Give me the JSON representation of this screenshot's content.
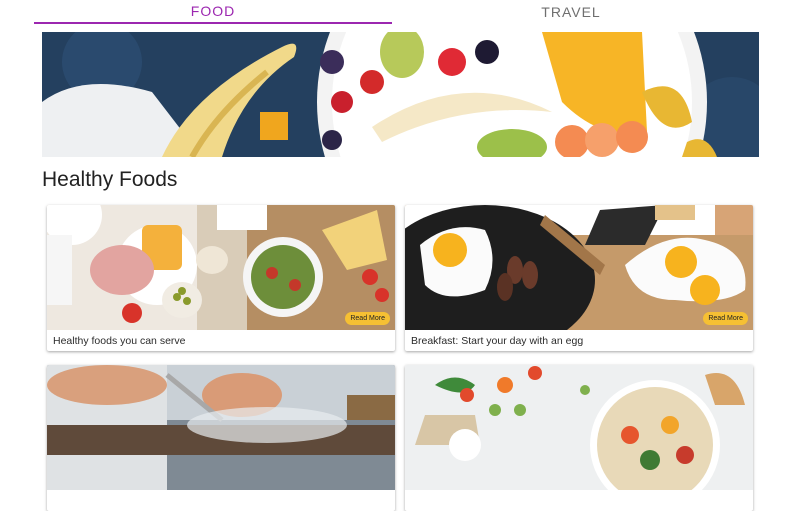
{
  "tabs": [
    {
      "label": "FOOD",
      "active": true
    },
    {
      "label": "TRAVEL",
      "active": false
    }
  ],
  "section": {
    "title": "Healthy Foods"
  },
  "cards": [
    {
      "caption": "Healthy foods you can serve",
      "button": "Read More"
    },
    {
      "caption": "Breakfast: Start your day with an egg",
      "button": "Read More"
    },
    {
      "caption": "",
      "button": ""
    },
    {
      "caption": "",
      "button": ""
    }
  ],
  "colors": {
    "accent": "#9c27b0",
    "button": "#f6c033"
  }
}
